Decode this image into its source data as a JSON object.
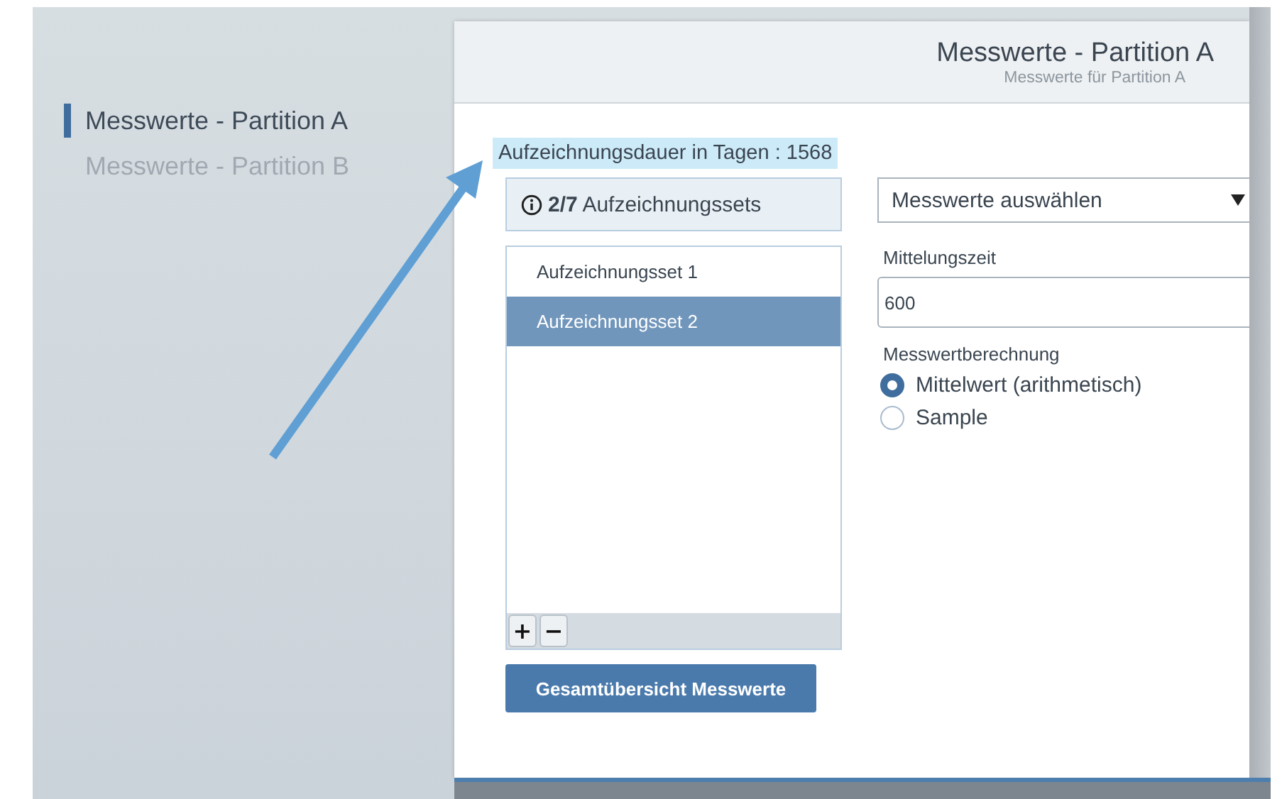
{
  "sidebar": {
    "items": [
      {
        "label": "Messwerte - Partition A",
        "selected": true
      },
      {
        "label": "Messwerte - Partition B",
        "selected": false
      }
    ]
  },
  "panel": {
    "title": "Messwerte - Partition A",
    "subtitle": "Messwerte für Partition A",
    "duration_label": "Aufzeichnungsdauer in Tagen : 1568",
    "set_counter": "**2/7** Aufzeichnungssets",
    "sets": [
      {
        "label": "Aufzeichnungsset 1",
        "selected": false
      },
      {
        "label": "Aufzeichnungsset 2",
        "selected": true
      }
    ],
    "list_buttons": [
      "+",
      "−"
    ],
    "overview_button": "Gesamtübersicht Messwerte",
    "select": {
      "value": "Messwerte auswählen"
    },
    "averaging": {
      "label": "Mittelungszeit",
      "value": "600"
    },
    "calculation": {
      "label": "Messwertberechnung",
      "options": [
        {
          "label": "Mittelwert (arithmetisch)",
          "selected": true
        },
        {
          "label": "Sample",
          "selected": false
        }
      ]
    }
  }
}
